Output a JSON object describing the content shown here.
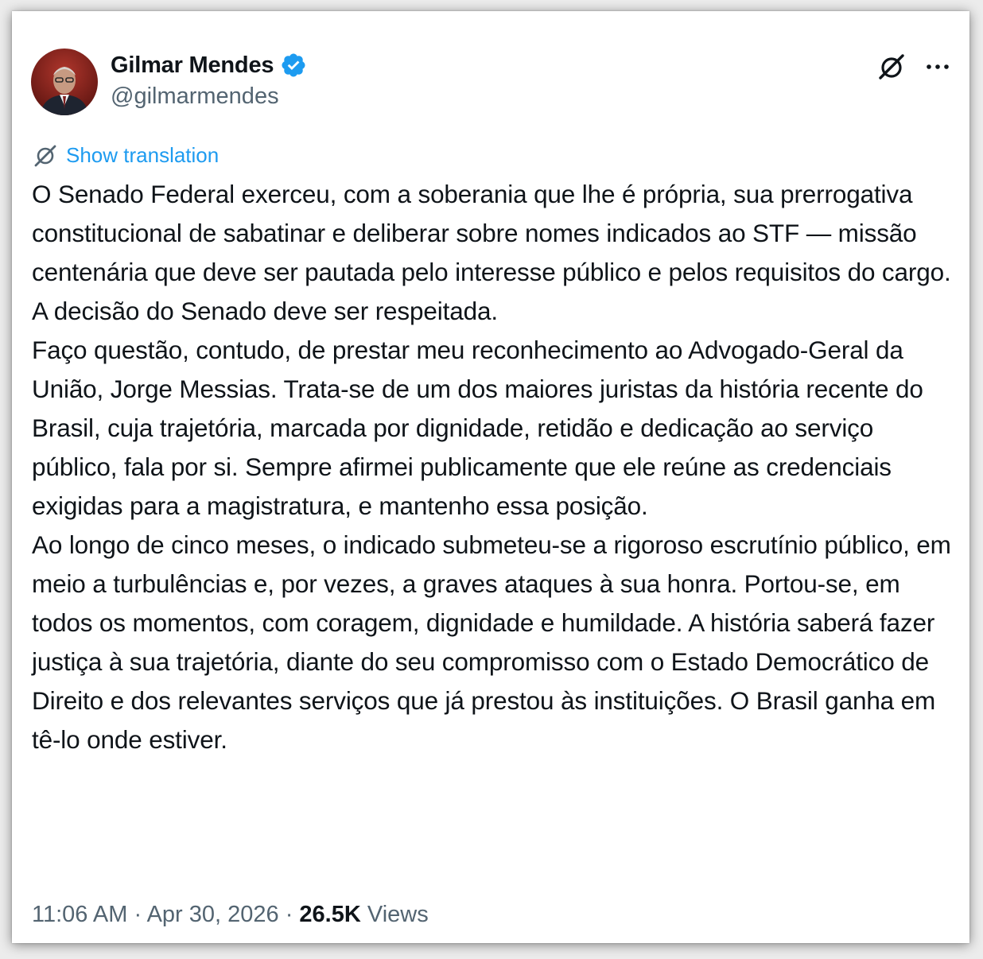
{
  "author": {
    "display_name": "Gilmar Mendes",
    "handle": "@gilmarmendes",
    "verified": true
  },
  "actions": {
    "grok_icon": "grok-icon",
    "more_icon": "more-options-icon"
  },
  "translation": {
    "label": "Show translation",
    "icon": "translate-icon"
  },
  "tweet": {
    "paragraphs": [
      "O Senado Federal exerceu, com a soberania que lhe é própria, sua prerrogativa constitucional de sabatinar e deliberar sobre nomes indicados ao STF — missão centenária que deve ser pautada pelo interesse público e pelos requisitos do cargo. A decisão do Senado deve ser respeitada.",
      "Faço questão, contudo, de prestar meu reconhecimento ao Advogado-Geral da União, Jorge Messias. Trata-se de um dos maiores juristas da história recente do Brasil, cuja trajetória, marcada por dignidade, retidão e dedicação ao serviço público, fala por si. Sempre afirmei publicamente que ele reúne as credenciais exigidas para a magistratura, e mantenho essa posição.",
      "Ao longo de cinco meses, o indicado submeteu-se a rigoroso escrutínio público, em meio a turbulências e, por vezes, a graves ataques à sua honra. Portou-se, em todos os momentos, com coragem, dignidade e humildade. A história saberá fazer justiça à sua trajetória, diante do seu compromisso com o Estado Democrático de Direito e dos relevantes serviços que já prestou às instituições. O Brasil ganha em tê-lo onde estiver."
    ]
  },
  "meta": {
    "time": "11:06 AM",
    "separator": " · ",
    "date": "Apr 30, 2026",
    "views_count": "26.5K",
    "views_label": "Views"
  },
  "colors": {
    "text": "#0f1419",
    "secondary": "#536471",
    "accent": "#1d9bf0"
  }
}
